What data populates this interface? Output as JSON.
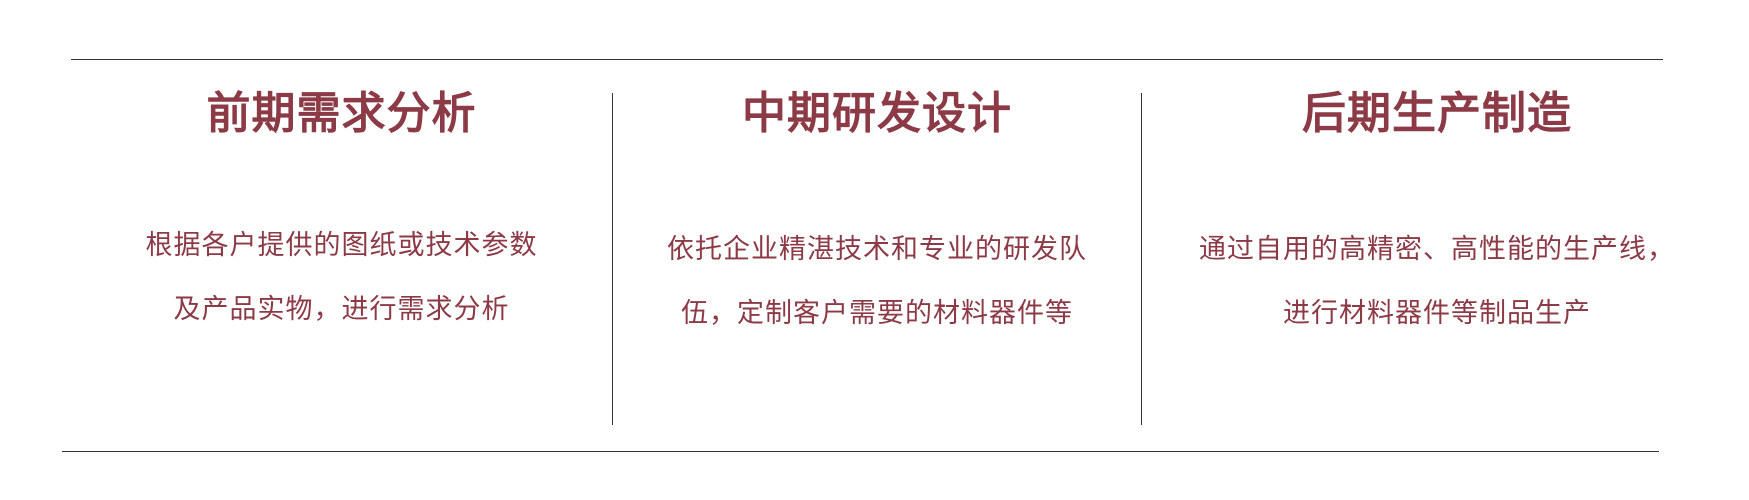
{
  "sections": [
    {
      "title": "前期需求分析",
      "lines": [
        "根据各户提供的图纸或技术参数",
        "及产品实物，进行需求分析"
      ]
    },
    {
      "title": "中期研发设计",
      "lines": [
        "依托企业精湛技术和专业的研发队",
        "伍，定制客户需要的材料器件等"
      ]
    },
    {
      "title": "后期生产制造",
      "lines": [
        "通过自用的高精密、高性能的生产线，",
        "进行材料器件等制品生产"
      ]
    }
  ],
  "colors": {
    "accent": "#8c3a46",
    "rule": "#333333",
    "background": "#ffffff"
  }
}
